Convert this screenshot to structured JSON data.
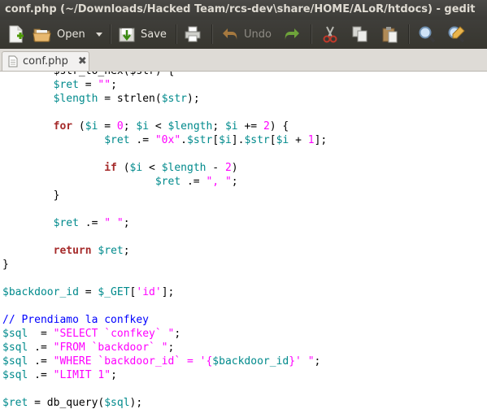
{
  "window": {
    "title": "conf.php (~/Downloads/Hacked Team/rcs-dev\\share/HOME/ALoR/htdocs) - gedit"
  },
  "toolbar": {
    "open_label": "Open",
    "save_label": "Save",
    "undo_label": "Undo"
  },
  "tabs": [
    {
      "label": "conf.php",
      "close": "✖"
    }
  ],
  "colors": {
    "variable": "#008a8c",
    "string": "#ff00ff",
    "keyword": "#a52a2a",
    "comment": "#0000ff"
  },
  "code_lines": [
    [
      {
        "t": "plain",
        "s": "        "
      },
      {
        "t": "plain",
        "s": "$str_to_hex($str) {"
      }
    ],
    [
      {
        "t": "plain",
        "s": "        "
      },
      {
        "t": "var",
        "s": "$ret"
      },
      {
        "t": "plain",
        "s": " = "
      },
      {
        "t": "str",
        "s": "\"\""
      },
      {
        "t": "plain",
        "s": ";"
      }
    ],
    [
      {
        "t": "plain",
        "s": "        "
      },
      {
        "t": "var",
        "s": "$length"
      },
      {
        "t": "plain",
        "s": " = strlen("
      },
      {
        "t": "var",
        "s": "$str"
      },
      {
        "t": "plain",
        "s": ");"
      }
    ],
    [],
    [
      {
        "t": "plain",
        "s": "        "
      },
      {
        "t": "kw",
        "s": "for"
      },
      {
        "t": "plain",
        "s": " ("
      },
      {
        "t": "var",
        "s": "$i"
      },
      {
        "t": "plain",
        "s": " = "
      },
      {
        "t": "num",
        "s": "0"
      },
      {
        "t": "plain",
        "s": "; "
      },
      {
        "t": "var",
        "s": "$i"
      },
      {
        "t": "plain",
        "s": " < "
      },
      {
        "t": "var",
        "s": "$length"
      },
      {
        "t": "plain",
        "s": "; "
      },
      {
        "t": "var",
        "s": "$i"
      },
      {
        "t": "plain",
        "s": " += "
      },
      {
        "t": "num",
        "s": "2"
      },
      {
        "t": "plain",
        "s": ") {"
      }
    ],
    [
      {
        "t": "plain",
        "s": "                "
      },
      {
        "t": "var",
        "s": "$ret"
      },
      {
        "t": "plain",
        "s": " .= "
      },
      {
        "t": "str",
        "s": "\"0x\""
      },
      {
        "t": "plain",
        "s": "."
      },
      {
        "t": "var",
        "s": "$str"
      },
      {
        "t": "plain",
        "s": "["
      },
      {
        "t": "var",
        "s": "$i"
      },
      {
        "t": "plain",
        "s": "]."
      },
      {
        "t": "var",
        "s": "$str"
      },
      {
        "t": "plain",
        "s": "["
      },
      {
        "t": "var",
        "s": "$i"
      },
      {
        "t": "plain",
        "s": " + "
      },
      {
        "t": "num",
        "s": "1"
      },
      {
        "t": "plain",
        "s": "];"
      }
    ],
    [],
    [
      {
        "t": "plain",
        "s": "                "
      },
      {
        "t": "kw",
        "s": "if"
      },
      {
        "t": "plain",
        "s": " ("
      },
      {
        "t": "var",
        "s": "$i"
      },
      {
        "t": "plain",
        "s": " < "
      },
      {
        "t": "var",
        "s": "$length"
      },
      {
        "t": "plain",
        "s": " - "
      },
      {
        "t": "num",
        "s": "2"
      },
      {
        "t": "plain",
        "s": ")"
      }
    ],
    [
      {
        "t": "plain",
        "s": "                        "
      },
      {
        "t": "var",
        "s": "$ret"
      },
      {
        "t": "plain",
        "s": " .= "
      },
      {
        "t": "str",
        "s": "\", \""
      },
      {
        "t": "plain",
        "s": ";"
      }
    ],
    [
      {
        "t": "plain",
        "s": "        }"
      }
    ],
    [],
    [
      {
        "t": "plain",
        "s": "        "
      },
      {
        "t": "var",
        "s": "$ret"
      },
      {
        "t": "plain",
        "s": " .= "
      },
      {
        "t": "str",
        "s": "\" \""
      },
      {
        "t": "plain",
        "s": ";"
      }
    ],
    [],
    [
      {
        "t": "plain",
        "s": "        "
      },
      {
        "t": "kw",
        "s": "return"
      },
      {
        "t": "plain",
        "s": " "
      },
      {
        "t": "var",
        "s": "$ret"
      },
      {
        "t": "plain",
        "s": ";"
      }
    ],
    [
      {
        "t": "plain",
        "s": "}"
      }
    ],
    [],
    [
      {
        "t": "var",
        "s": "$backdoor_id"
      },
      {
        "t": "plain",
        "s": " = "
      },
      {
        "t": "var",
        "s": "$_GET"
      },
      {
        "t": "plain",
        "s": "["
      },
      {
        "t": "str",
        "s": "'id'"
      },
      {
        "t": "plain",
        "s": "];"
      }
    ],
    [],
    [
      {
        "t": "com",
        "s": "// Prendiamo la confkey"
      }
    ],
    [
      {
        "t": "var",
        "s": "$sql"
      },
      {
        "t": "plain",
        "s": "  = "
      },
      {
        "t": "str",
        "s": "\"SELECT `confkey` \""
      },
      {
        "t": "plain",
        "s": ";"
      }
    ],
    [
      {
        "t": "var",
        "s": "$sql"
      },
      {
        "t": "plain",
        "s": " .= "
      },
      {
        "t": "str",
        "s": "\"FROM `backdoor` \""
      },
      {
        "t": "plain",
        "s": ";"
      }
    ],
    [
      {
        "t": "var",
        "s": "$sql"
      },
      {
        "t": "plain",
        "s": " .= "
      },
      {
        "t": "str",
        "s": "\"WHERE `backdoor_id` = '{"
      },
      {
        "t": "var",
        "s": "$backdoor_id"
      },
      {
        "t": "str",
        "s": "}' \""
      },
      {
        "t": "plain",
        "s": ";"
      }
    ],
    [
      {
        "t": "var",
        "s": "$sql"
      },
      {
        "t": "plain",
        "s": " .= "
      },
      {
        "t": "str",
        "s": "\"LIMIT 1\""
      },
      {
        "t": "plain",
        "s": ";"
      }
    ],
    [],
    [
      {
        "t": "var",
        "s": "$ret"
      },
      {
        "t": "plain",
        "s": " = db_query("
      },
      {
        "t": "var",
        "s": "$sql"
      },
      {
        "t": "plain",
        "s": ");"
      }
    ]
  ]
}
